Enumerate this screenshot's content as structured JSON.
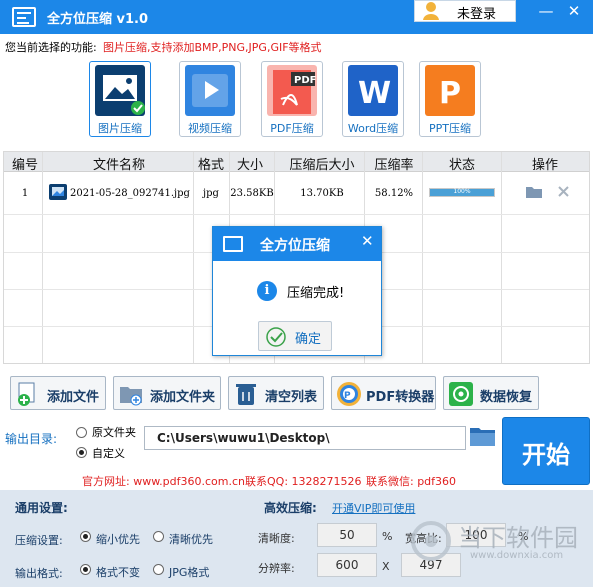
{
  "app": {
    "title": "全方位压缩 v1.0",
    "login": "未登录",
    "minimize": "—",
    "close": "✕"
  },
  "functions": {
    "current_label": "您当前选择的功能:",
    "current_desc": "图片压缩,支持添加BMP,PNG,JPG,GIF等格式",
    "modes": [
      {
        "label": "图片压缩",
        "color": "#0b3e70",
        "selected": true
      },
      {
        "label": "视频压缩",
        "color": "#2f84e0"
      },
      {
        "label": "PDF压缩",
        "color": "#f35a4f"
      },
      {
        "label": "Word压缩",
        "color": "#1f63c8"
      },
      {
        "label": "PPT压缩",
        "color": "#f57d1f"
      }
    ]
  },
  "table": {
    "headers": [
      "编号",
      "文件名称",
      "格式",
      "大小",
      "压缩后大小",
      "压缩率",
      "状态",
      "操作"
    ],
    "rows": [
      {
        "id": "1",
        "name": "2021-05-28_092741.jpg",
        "format": "jpg",
        "size": "23.58KB",
        "compressed": "13.70KB",
        "rate": "58.12%",
        "status": "100%",
        "progress": 1.0
      }
    ]
  },
  "dialog": {
    "title": "全方位压缩",
    "message": "压缩完成!",
    "ok": "确定",
    "close": "✕"
  },
  "toolbar": {
    "add_file": "添加文件",
    "add_folder": "添加文件夹",
    "clear": "清空列表",
    "pdf_converter": "PDF转换器",
    "recover": "数据恢复"
  },
  "output": {
    "label": "输出目录:",
    "opt_original": "原文件夹",
    "opt_custom": "自定义",
    "path": "C:\\Users\\wuwu1\\Desktop\\",
    "start": "开始"
  },
  "footer": {
    "site": "官方网址: www.pdf360.com.cn",
    "qq": "联系QQ: 1328271526",
    "wechat": "联系微信: pdf360"
  },
  "settings": {
    "general": "通用设置:",
    "efficient": "高效压缩:",
    "vip_link": "开通VIP即可使用",
    "mode_label": "压缩设置:",
    "mode_small": "缩小优先",
    "mode_clear": "清晰优先",
    "format_label": "输出格式:",
    "format_keep": "格式不变",
    "format_jpg": "JPG格式",
    "clarity_label": "清晰度:",
    "clarity": "50",
    "clarity_unit": "%",
    "ratio_label": "宽高比:",
    "ratio": "100",
    "ratio_unit": "%",
    "resolution_label": "分辨率:",
    "res_w": "600",
    "res_x": "X",
    "res_h": "497"
  },
  "watermark": {
    "text": "当下软件园",
    "url": "www.downxia.com"
  }
}
